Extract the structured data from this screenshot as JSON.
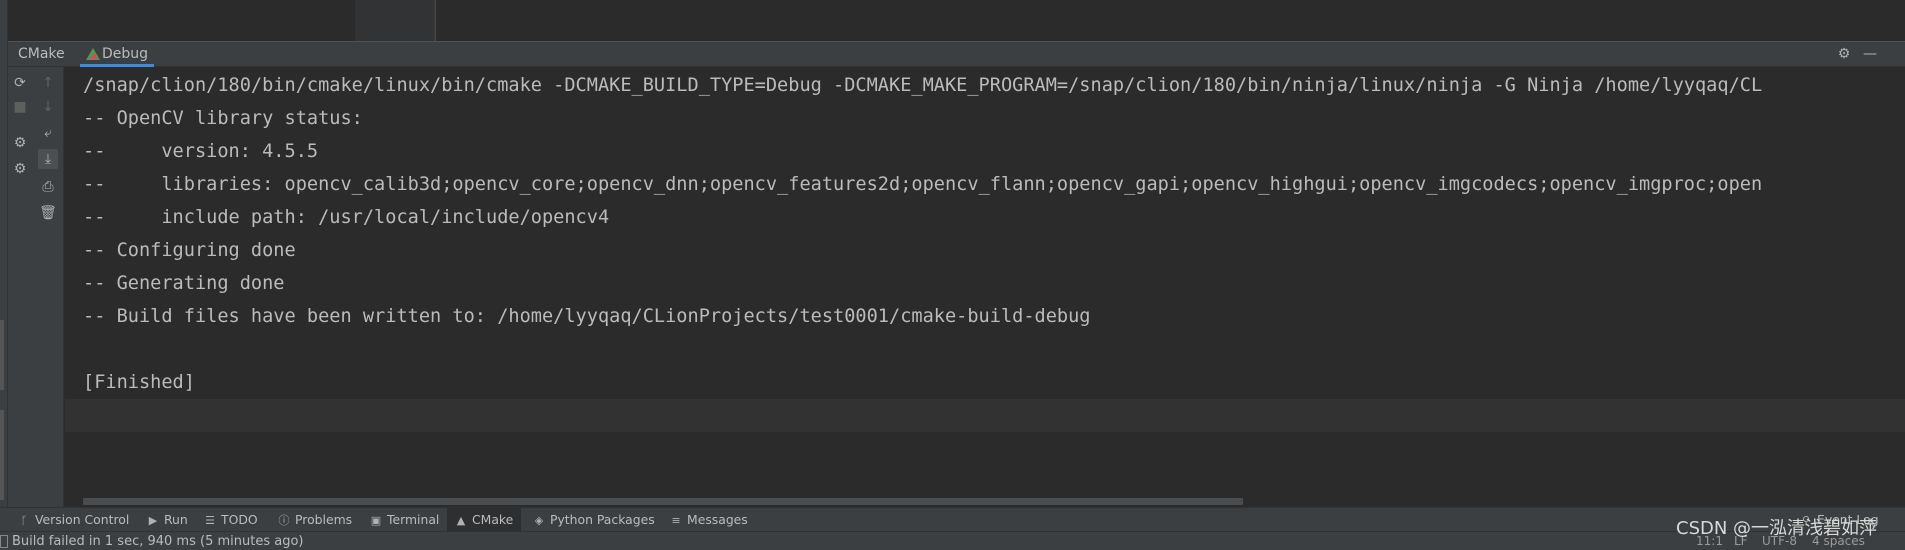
{
  "tool_window": {
    "tabs": [
      {
        "label": "CMake"
      },
      {
        "label": "Debug"
      }
    ]
  },
  "console": {
    "lines": [
      "/snap/clion/180/bin/cmake/linux/bin/cmake -DCMAKE_BUILD_TYPE=Debug -DCMAKE_MAKE_PROGRAM=/snap/clion/180/bin/ninja/linux/ninja -G Ninja /home/lyyqaq/CL",
      "-- OpenCV library status:",
      "--     version: 4.5.5",
      "--     libraries: opencv_calib3d;opencv_core;opencv_dnn;opencv_features2d;opencv_flann;opencv_gapi;opencv_highgui;opencv_imgcodecs;opencv_imgproc;open",
      "--     include path: /usr/local/include/opencv4",
      "-- Configuring done",
      "-- Generating done",
      "-- Build files have been written to: /home/lyyqaq/CLionProjects/test0001/cmake-build-debug",
      "",
      "[Finished]"
    ]
  },
  "bottom_tabs": [
    {
      "label": "Version Control",
      "icon": "branch-icon"
    },
    {
      "label": "Run",
      "icon": "play-icon"
    },
    {
      "label": "TODO",
      "icon": "list-icon"
    },
    {
      "label": "Problems",
      "icon": "info-icon"
    },
    {
      "label": "Terminal",
      "icon": "terminal-icon"
    },
    {
      "label": "CMake",
      "icon": "cmake-icon"
    },
    {
      "label": "Python Packages",
      "icon": "layers-icon"
    },
    {
      "label": "Messages",
      "icon": "messages-icon"
    }
  ],
  "event_log": {
    "label": "Event Log"
  },
  "status_bar": {
    "message": "Build failed in 1 sec, 940 ms (5 minutes ago)",
    "position": "11:1",
    "line_separator": "LF",
    "encoding": "UTF-8",
    "indent": "4 spaces"
  },
  "watermark": "CSDN @一泓清浅碧如萍"
}
